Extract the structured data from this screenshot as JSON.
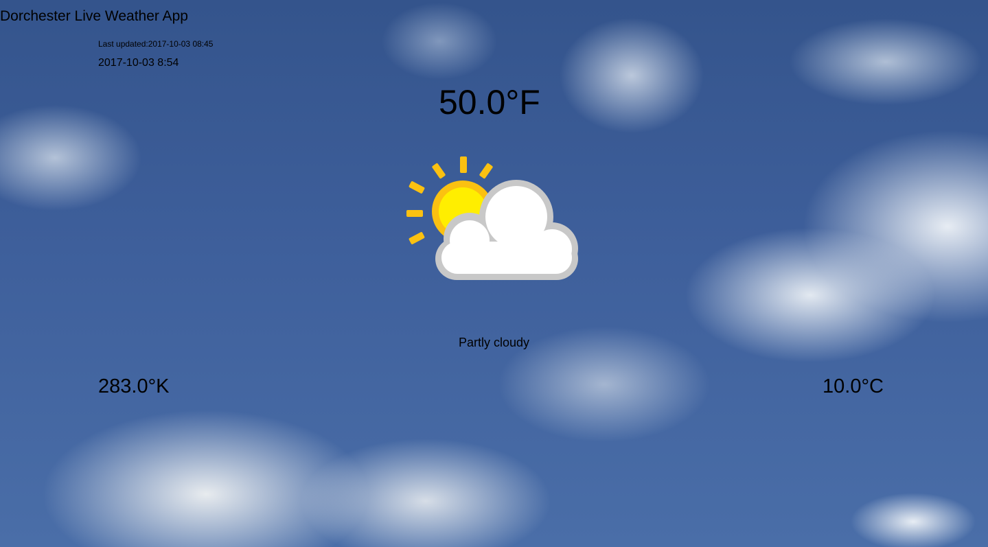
{
  "app": {
    "title": "Dorchester Live Weather App"
  },
  "status": {
    "last_updated": "Last updated:2017-10-03 08:45",
    "local_time": "2017-10-03 8:54"
  },
  "weather": {
    "temp_fahrenheit": "50.0°F",
    "temp_kelvin": "283.0°K",
    "temp_celsius": "10.0°C",
    "condition": "Partly cloudy",
    "icon": "partly-cloudy-icon"
  },
  "colors": {
    "sky": "#3e5f9b",
    "sun": "#fbc111",
    "sun_core": "#ffee00",
    "cloud": "#ffffff",
    "cloud_outline": "#c8c8c8",
    "text": "#000000"
  }
}
